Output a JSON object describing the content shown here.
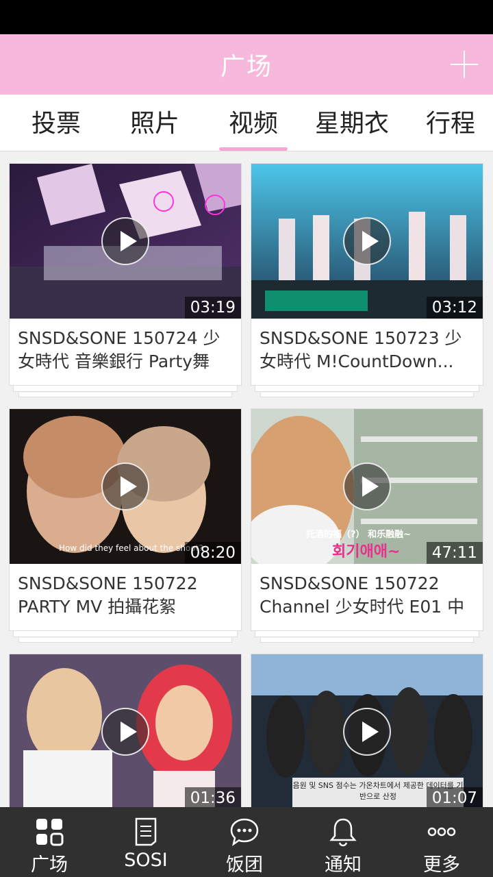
{
  "header": {
    "title": "广场"
  },
  "tabs": [
    "投票",
    "照片",
    "视频",
    "星期衣",
    "行程"
  ],
  "active_tab": "视频",
  "videos": [
    {
      "duration": "03:19",
      "title": "SNSD&SONE 150724 少女時代 音樂銀行 Party舞"
    },
    {
      "duration": "03:12",
      "title": "SNSD&SONE 150723 少女時代 M!CountDown..."
    },
    {
      "duration": "08:20",
      "title": "SNSD&SONE 150722 PARTY MV 拍攝花絮"
    },
    {
      "duration": "47:11",
      "title": "SNSD&SONE 150722 Channel 少女时代 E01 中"
    },
    {
      "duration": "01:36",
      "title": ""
    },
    {
      "duration": "01:07",
      "title": ""
    }
  ],
  "thumb_captions": {
    "v3": "How did they feel about the shoot?",
    "v4_top": "托酒的福（?） 和乐融融~",
    "v4_bottom": "회기애애~",
    "v6": "음원 및 SNS 점수는 가온차트에서 제공한 데이터를 기반으로 산정"
  },
  "bottom_nav": [
    {
      "label": "广场",
      "icon": "grid-icon"
    },
    {
      "label": "SOSI",
      "icon": "document-icon"
    },
    {
      "label": "饭团",
      "icon": "chat-icon"
    },
    {
      "label": "通知",
      "icon": "bell-icon"
    },
    {
      "label": "更多",
      "icon": "more-icon"
    }
  ]
}
